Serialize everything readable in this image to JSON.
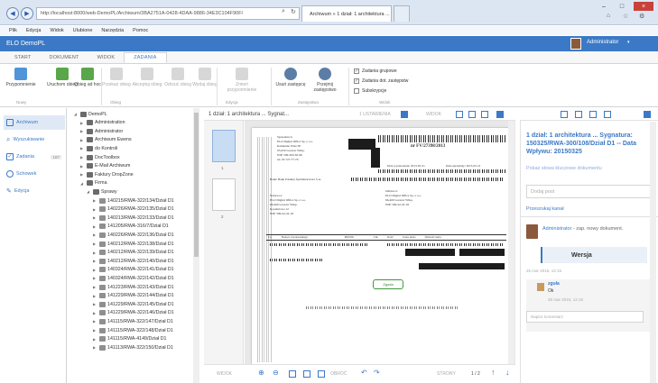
{
  "browser": {
    "url": "http://localhost:8000/web-DemoPL/Archiwum/3BA2751A-0428-4DAA-9886-34E3C104F90F/",
    "tab_title": "Archiwum » 1 dział: 1 architektura ...",
    "menu": [
      "Plik",
      "Edycja",
      "Widok",
      "Ulubione",
      "Narzędzia",
      "Pomoc"
    ]
  },
  "app": {
    "title": "ELO DemoPL",
    "user": "Administrator"
  },
  "ribbon_tabs": [
    "START",
    "DOKUMENT",
    "WIDOK",
    "ZADANIA"
  ],
  "ribbon": {
    "buttons": [
      {
        "label": "Przypomnienie",
        "disabled": false
      },
      {
        "label": "Uruchom obieg",
        "disabled": false
      },
      {
        "label": "Obieg ad hoc",
        "disabled": false
      },
      {
        "label": "Przekaż obieg",
        "disabled": true
      },
      {
        "label": "Akceptuj obieg",
        "disabled": true
      },
      {
        "label": "Odrzuć obieg",
        "disabled": true
      },
      {
        "label": "Wydaj obieg",
        "disabled": true
      },
      {
        "label": "Zmień przypomnienie",
        "disabled": true
      },
      {
        "label": "Usuń zastępcę",
        "disabled": false
      },
      {
        "label": "Przejmij zastępstwo",
        "disabled": false
      }
    ],
    "groups": [
      "Nowy",
      "Obieg",
      "Edycja",
      "Zastępstwo",
      "Widok"
    ],
    "checks": [
      {
        "label": "Zadania grupowe",
        "checked": true
      },
      {
        "label": "Zadania dot. zastępstw",
        "checked": true
      },
      {
        "label": "Subskrypcje",
        "checked": false
      }
    ]
  },
  "leftnav": [
    {
      "label": "Archiwum",
      "active": true,
      "count": ""
    },
    {
      "label": "Wyszukiwanie",
      "active": false,
      "count": ""
    },
    {
      "label": "Zadania",
      "active": false,
      "count": "187"
    },
    {
      "label": "Schowek",
      "active": false,
      "count": ""
    },
    {
      "label": "Edycja",
      "active": false,
      "count": ""
    }
  ],
  "tree": [
    {
      "label": "DemoPL",
      "level": 0,
      "open": true
    },
    {
      "label": "Administration",
      "level": 1,
      "open": false
    },
    {
      "label": "Administrator",
      "level": 1,
      "open": false
    },
    {
      "label": "Archiwum Ewens",
      "level": 1,
      "open": false
    },
    {
      "label": "do Kontroli",
      "level": 1,
      "open": false
    },
    {
      "label": "DocToolbox",
      "level": 1,
      "open": false
    },
    {
      "label": "E-Mail Archiwum",
      "level": 1,
      "open": false
    },
    {
      "label": "Faktury DropZone",
      "level": 1,
      "open": false
    },
    {
      "label": "Firma",
      "level": 1,
      "open": true
    },
    {
      "label": "Sprawy",
      "level": 2,
      "open": true
    },
    {
      "label": "140215/RWA-322/134/Dział D1",
      "level": 3
    },
    {
      "label": "140226/RWA-322/135/Dział D1",
      "level": 3
    },
    {
      "label": "140213/RWA-322/133/Dział D1",
      "level": 3
    },
    {
      "label": "141205/RWA-316/7/Dział D1",
      "level": 3
    },
    {
      "label": "140226/RWA-322/136/Dział D1",
      "level": 3
    },
    {
      "label": "140212/RWA-322/138/Dział D1",
      "level": 3
    },
    {
      "label": "140212/RWA-322/139/Dział D1",
      "level": 3
    },
    {
      "label": "140212/RWA-322/140/Dział D1",
      "level": 3
    },
    {
      "label": "140324/RWA-322/141/Dział D1",
      "level": 3
    },
    {
      "label": "140324/RWA-322/142/Dział D1",
      "level": 3
    },
    {
      "label": "141223/RWA-322/143/Dział D1",
      "level": 3
    },
    {
      "label": "141229/RWA-322/144/Dział D1",
      "level": 3
    },
    {
      "label": "141229/RWA-322/145/Dział D1",
      "level": 3
    },
    {
      "label": "141229/RWA-322/146/Dział D1",
      "level": 3
    },
    {
      "label": "141115/RWA-322/147/Dział D1",
      "level": 3
    },
    {
      "label": "141115/RWA-322/148/Dział D1",
      "level": 3
    },
    {
      "label": "141115/RWA-4149/Dział D1",
      "level": 3
    },
    {
      "label": "141113/RWA-322/150/Dział D1",
      "level": 3
    }
  ],
  "viewer": {
    "title": "1 dział: 1 architektura ... Sygnat...",
    "toolbar_labels": [
      "1 USTAWIENIA",
      "WIDOK"
    ],
    "page_thumbs": [
      "1",
      "2"
    ],
    "footer_labels": [
      "WIDOK",
      "OBRÓĆ",
      "STRONY",
      "1 / 2"
    ],
    "doc": {
      "invoice_no": "nr FV/27398/2013",
      "seller_lines": [
        "Sprzedawca:",
        "ELO Digital Office Sp. z o.o.",
        "Kamienna Wieś 38",
        "05-650 Gorzów Wlkp.",
        "NIP: 599-293-30-96",
        "tel. 95 727-77-79"
      ],
      "buyer_lines": [
        "Nabywca:",
        "ELO Digital Office Sp. z o.o.",
        "66-400 Gorzów Wlkp.",
        "Kopalniowa 12",
        "NIP: 599-22-22-18"
      ],
      "recipient_lines": [
        "Odbiorca:",
        "ELO Digital Office Sp. z o.o.",
        "66-400 Gorzów Wlkp.",
        "NIP: 599-22-22-18"
      ],
      "issue_date": "Data wystawienia: 2013-05-31",
      "sale_date": "Data sprzedaży: 2013-05-31",
      "table_headers": [
        "Lp.",
        "Nazwa towaru/usługi",
        "PKWiU",
        "J.m.",
        "Ilość",
        "Cena netto",
        "Wartość netto"
      ],
      "stamp": "Zgoda",
      "bank_line": "Bank: Bank Polskiej Spółdzielczości S.A."
    }
  },
  "right_panel": {
    "title": "1 dział: 1 architektura ... Sygnatura: 150325/RWA-300/108/Dział D1 -- Data Wpływu: 20150325",
    "link_related": "Pokaż słowa kluczowe dokumentu",
    "post_placeholder": "Dodaj post",
    "link_more": "Przeszukaj kanał",
    "feed_author": "Administrator",
    "feed_action": "- zap. nowy dokument.",
    "feed_item": "Wersja",
    "feed_time": "25 mar 2015, 12:15",
    "comment_author": "zguła",
    "comment_text": "Ok",
    "comment_time": "25 mar 2015, 12:15",
    "comment_placeholder": "Napisz komentarz"
  },
  "colors": {
    "accent": "#3b79c6",
    "header": "#3b79c6"
  }
}
